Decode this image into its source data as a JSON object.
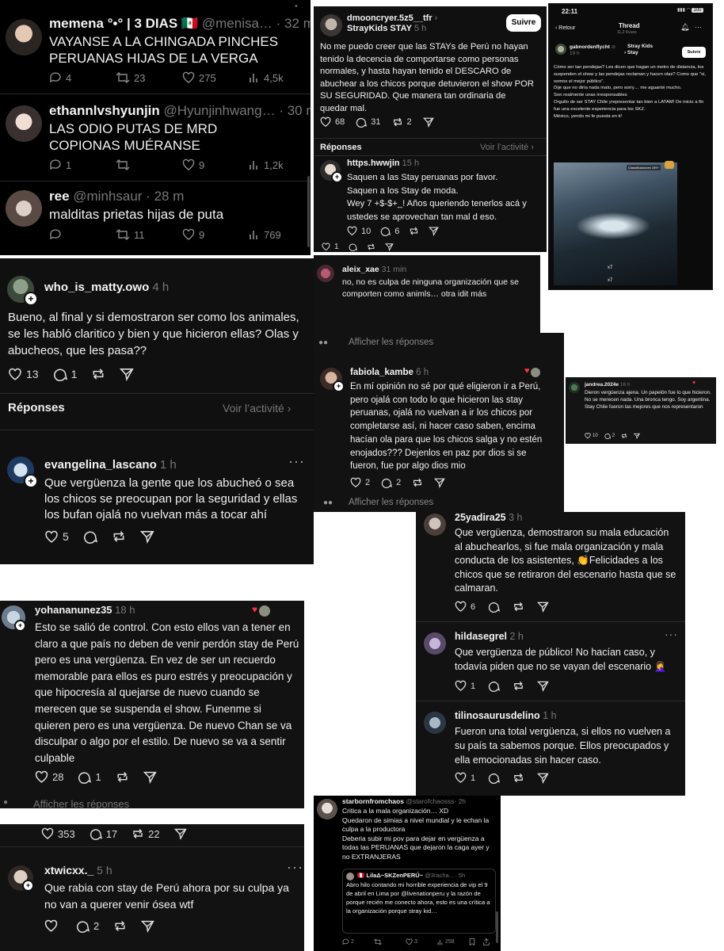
{
  "twitter_top": {
    "tweets": [
      {
        "name": "memena °•° | 3 DIAS 🇲🇽",
        "handle": "@menisa…",
        "time": "· 32 m",
        "text": "VAYANSE A LA CHINGADA PINCHES PERUANAS HIJAS DE LA VERGA",
        "replies": "4",
        "retweets": "23",
        "likes": "275",
        "views": "4,5k"
      },
      {
        "name": "ethannlvshyunjin",
        "handle": "@Hyunjinhwang…",
        "time": "· 30 m",
        "text": "LAS ODIO PUTAS DE MRD COPIONAS MUÉRANSE",
        "replies": "1",
        "retweets": "",
        "likes": "9",
        "views": "1,2k"
      },
      {
        "name": "ree",
        "handle": "@minhsaur",
        "time": "· 28 m",
        "text": "malditas prietas hijas de puta",
        "replies": "",
        "retweets": "11",
        "likes": "9",
        "views": "769"
      }
    ]
  },
  "threads_matty": {
    "user": "who_is_matty.owo",
    "time": "4 h",
    "text": "Bueno, al final y si demostraron ser como los animales, se les habló claritico y bien y que hicieron ellas? Olas y abucheos, que les pasa??",
    "likes": "13",
    "replies": "1",
    "replies_label": "Réponses",
    "activity_label": "Voir l’activité",
    "reply": {
      "user": "evangelina_lascano",
      "time": "1 h",
      "text": "Que vergüenza la gente que los abucheó o sea los chicos se preocupan por la seguridad y ellas los bufan ojalá no vuelvan más a tocar ahí",
      "likes": "5"
    }
  },
  "threads_dmoon": {
    "user": "dmooncryer.5z5__tfr",
    "subtitle": "StrayKids STAY",
    "time": "5 h",
    "follow": "Suivre",
    "text": "No me puedo creer que las STAYs de Perú no hayan tenido la decencia de comportarse como personas normales, y hasta hayan tenido el DESCARO de abuchear a los chicos porque detuvieron el show POR SU SEGURIDAD. Que manera tan ordinaria de quedar mal.",
    "likes": "68",
    "replies": "31",
    "reposts": "2",
    "replies_label": "Réponses",
    "activity_label": "Voir l’activité",
    "reply": {
      "user": "https.hwwjin",
      "time": "15 h",
      "text": "Saquen a las Stay peruanas por favor.\nSaquen a los Stay de moda.\nWey 7 +$-$+_! Años queriendo tenerlos acá y ustedes se aprovechan tan mal d eso.",
      "likes": "10",
      "replies": "6"
    },
    "partial_count": "1"
  },
  "phone_thread": {
    "clock": "22:11",
    "battery": "100",
    "back": "Retour",
    "title": "Thread",
    "views": "11,2 Kvues",
    "user": "gabnordenflycht",
    "community": "Stray Kids Stay",
    "time": "19 h",
    "follow": "Suivre",
    "text": "Cómo ser tan pendejas? Les dicen que hagan un metro de distancia, los suspenden el show y las pendejas reclaman y hacen olas? Como que \"si, somos el mejor público\".\nDije que no diría nada malo, pero sorry… me aguanté mucho.\nSon realmente unas irresponsables\nOrgullo de ser  STAY Chile yrepresentar tan bien a LATAM! De inicio a fin fue una excelente experiencia para los SKZ.\nMéxico, yendo mi fe puesta en ti!",
    "video_badge": "Classificaciones 199+",
    "video_x1": "x7",
    "video_x2": "x7"
  },
  "threads_aleix": {
    "user": "aleix_xae",
    "time": "31 min",
    "text": "no, no es culpa de ninguna organización que se comporten como animls… otra idit más",
    "show_replies": "Afficher les réponses"
  },
  "threads_fabiola": {
    "user": "fabiola_kambe",
    "time": "6 h",
    "text": "En mí opinión no sé por qué eligieron ir a Perú, pero ojalá con todo lo que hicieron las stay peruanas, ojalá no vuelvan a ir los chicos por completarse así, ni hacer caso saben, encima hacían ola para que los chicos salga y no estén enojados??? Dejenlos en paz por dios si se fueron, fue por algo dios mio",
    "likes": "2",
    "replies": "2",
    "show_replies": "Afficher les réponses"
  },
  "threads_jandrea": {
    "user": "jandrea.2024e",
    "time": "16 h",
    "text": "Dieron vergüenza ajena. Un papelón fue lo que hicieron. No se merecen nada. Una bronca tengo. Soy argentina.\nStay Chile fueron las mejores que nos representaron",
    "likes": "10",
    "replies": "2"
  },
  "threads_right": {
    "posts": [
      {
        "user": "25yadira25",
        "time": "3 h",
        "text": "Que vergüenza, demostraron su mala educación al abuchearlos, si fue mala organización y mala conducta de los asistentes, 👏Felicidades a los chicos que se retiraron del escenario hasta que se calmaran.",
        "likes": "6",
        "replies": ""
      },
      {
        "user": "hildasegrel",
        "time": "2 h",
        "text": "Que vergüenza de público! No hacían caso,  y todavía piden que no se vayan del escenario 🤦‍♀️",
        "likes": "1",
        "replies": ""
      },
      {
        "user": "tilinosaurusdelino",
        "time": "1 h",
        "text": "Fueron una total vergüenza, si ellos no vuelven a su país ta sabemos porque. Ellos preocupados y ella emocionadas sin hacer caso.",
        "likes": "1",
        "replies": ""
      }
    ]
  },
  "threads_yohanan": {
    "user": "yohananunez35",
    "time": "18 h",
    "text": "Esto se salió de control. Con esto ellos van a tener en claro a que país no deben de venir perdón stay de Perú pero es una vergüenza. En vez de ser un recuerdo memorable para ellos es puro estrés y preocupación y que hipocresía al quejarse de nuevo cuando se merecen que se suspenda el show. Funenme si quieren pero es una vergüenza. De nuevo Chan se va disculpar o algo por el estilo. De nuevo se va a sentir culpable",
    "likes": "28",
    "replies": "1",
    "show_replies": "Afficher les réponses"
  },
  "threads_xtwic": {
    "prev_likes": "353",
    "prev_replies": "17",
    "prev_reposts": "22",
    "user": "xtwicxx._",
    "time": "5 h",
    "text": "Que rabia con stay de Perú ahora por su culpa ya no van a querer venir ósea wtf",
    "likes": "",
    "replies": "2"
  },
  "twitter_starborn": {
    "name": "starbornfromchaos",
    "handle": "@starofchaosss",
    "time": "· 2h",
    "text": "Critica a la mala organización… XD\nQuedaron de simias a nivel mundial y le echan la culpa a la productora\nDeberia subir mi pov para dejar en vergüenza a todas las PERUANAS que dejaron la caga ayer y no EXTRANJERAS",
    "quote": {
      "name": "🇵🇪 LilaΔ~SKZenPERÚ~",
      "handle": "@3racha…",
      "time": "· 5h",
      "text": "Abro hilo contando mi horrible experiencia de vip el 9 de abril en Lima por @livenationperu y la razón de porque recién me conecto ahora, esto es una crítica a la organización porque stray kid…"
    },
    "replies": "2",
    "retweets": "3",
    "views": "258"
  },
  "colors": {
    "threads_bg": "#101010",
    "twitter_bg": "#000000",
    "link_blue": "#1d9bf0"
  }
}
